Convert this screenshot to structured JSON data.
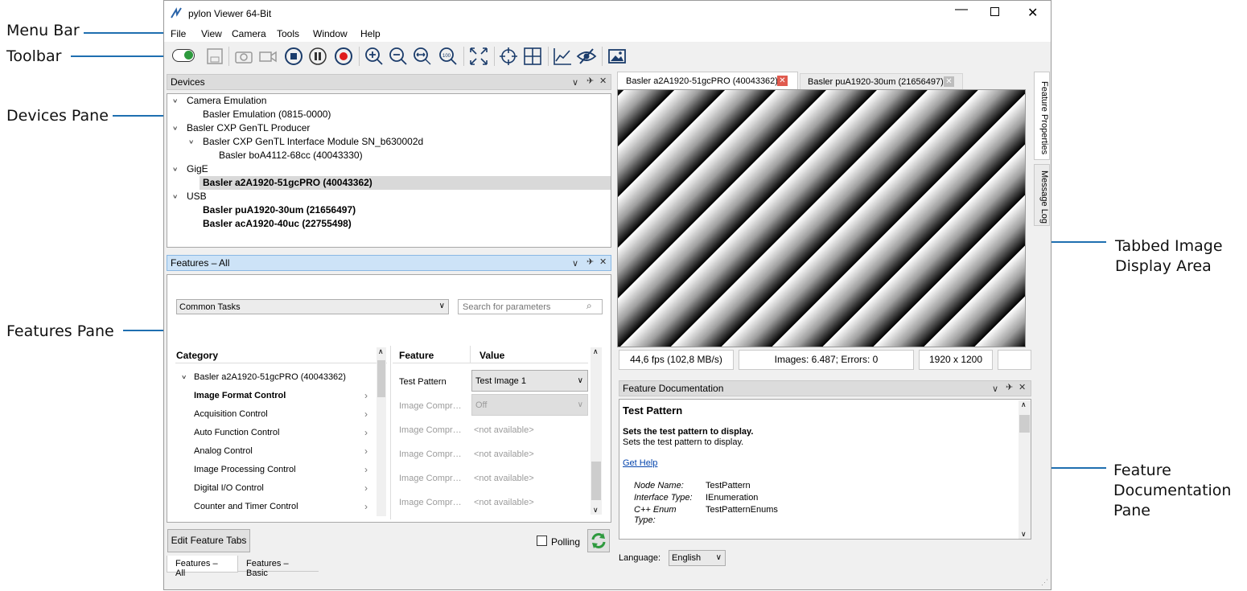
{
  "callouts": {
    "menu_bar": "Menu Bar",
    "toolbar": "Toolbar",
    "devices_pane": "Devices Pane",
    "features_pane": "Features Pane",
    "image_area_line1": "Tabbed Image",
    "image_area_line2": "Display Area",
    "doc_pane_line1": "Feature",
    "doc_pane_line2": "Documentation",
    "doc_pane_line3": "Pane"
  },
  "window": {
    "title": "pylon Viewer 64-Bit"
  },
  "menu": [
    "File",
    "View",
    "Camera",
    "Tools",
    "Window",
    "Help"
  ],
  "toolbar_icons": [
    "toggle-icon",
    "save-icon",
    "camera-icon",
    "video-icon",
    "stop-icon",
    "pause-icon",
    "record-icon",
    "zoom-in-icon",
    "zoom-out-icon",
    "zoom-fit-icon",
    "zoom-100-icon",
    "fullscreen-icon",
    "crosshair-icon",
    "grid-icon",
    "chart-icon",
    "hide-icon",
    "image-icon"
  ],
  "devices": {
    "title": "Devices",
    "rows": [
      {
        "label": "Camera Emulation",
        "indent": 0,
        "expand": true,
        "bold": false,
        "sel": false
      },
      {
        "label": "Basler Emulation (0815-0000)",
        "indent": 1,
        "expand": false,
        "bold": false,
        "sel": false
      },
      {
        "label": "Basler CXP GenTL Producer",
        "indent": 0,
        "expand": true,
        "bold": false,
        "sel": false
      },
      {
        "label": "Basler CXP GenTL Interface Module SN_b630002d",
        "indent": 1,
        "expand": true,
        "bold": false,
        "sel": false
      },
      {
        "label": "Basler boA4112-68cc (40043330)",
        "indent": 2,
        "expand": false,
        "bold": false,
        "sel": false
      },
      {
        "label": "GigE",
        "indent": 0,
        "expand": true,
        "bold": false,
        "sel": false
      },
      {
        "label": "Basler a2A1920-51gcPRO (40043362)",
        "indent": 1,
        "expand": false,
        "bold": true,
        "sel": true
      },
      {
        "label": "USB",
        "indent": 0,
        "expand": true,
        "bold": false,
        "sel": false
      },
      {
        "label": "Basler puA1920-30um (21656497)",
        "indent": 1,
        "expand": false,
        "bold": true,
        "sel": false
      },
      {
        "label": "Basler acA1920-40uc (22755498)",
        "indent": 1,
        "expand": false,
        "bold": true,
        "sel": false
      }
    ]
  },
  "features": {
    "title": "Features – All",
    "task_combo": "Common Tasks",
    "search_placeholder": "Search for parameters",
    "category_header": "Category",
    "feature_header": "Feature",
    "value_header": "Value",
    "categories": [
      {
        "label": "Basler a2A1920-51gcPRO (40043362)",
        "root": true,
        "bold": false
      },
      {
        "label": "Image Format Control",
        "root": false,
        "bold": true
      },
      {
        "label": "Acquisition Control",
        "root": false,
        "bold": false
      },
      {
        "label": "Auto Function Control",
        "root": false,
        "bold": false
      },
      {
        "label": "Analog Control",
        "root": false,
        "bold": false
      },
      {
        "label": "Image Processing Control",
        "root": false,
        "bold": false
      },
      {
        "label": "Digital I/O Control",
        "root": false,
        "bold": false
      },
      {
        "label": "Counter and Timer Control",
        "root": false,
        "bold": false
      }
    ],
    "params": [
      {
        "name": "Test Pattern",
        "value": "Test Image 1",
        "combo": true,
        "enabled": true
      },
      {
        "name": "Image Compr…",
        "value": "Off",
        "combo": true,
        "enabled": false
      },
      {
        "name": "Image Compr…",
        "value": "<not available>",
        "combo": false,
        "enabled": false
      },
      {
        "name": "Image Compr…",
        "value": "<not available>",
        "combo": false,
        "enabled": false
      },
      {
        "name": "Image Compr…",
        "value": "<not available>",
        "combo": false,
        "enabled": false
      },
      {
        "name": "Image Compr…",
        "value": "<not available>",
        "combo": false,
        "enabled": false
      }
    ],
    "edit_tabs_button": "Edit Feature Tabs",
    "polling_label": "Polling",
    "bottom_tabs": [
      "Features – All",
      "Features – Basic"
    ]
  },
  "image_tabs": [
    "Basler a2A1920-51gcPRO (40043362)",
    "Basler puA1920-30um (21656497)"
  ],
  "side_tabs": [
    "Feature Properties",
    "Message Log"
  ],
  "status": {
    "fps": "44,6 fps (102,8 MB/s)",
    "images": "Images: 6.487; Errors: 0",
    "resolution": "1920 x 1200"
  },
  "doc": {
    "title": "Feature Documentation",
    "heading": "Test Pattern",
    "summary": "Sets the test pattern to display.",
    "description": "Sets the test pattern to display.",
    "help_link": "Get Help",
    "node_name_key": "Node Name:",
    "node_name_val": "TestPattern",
    "interface_key": "Interface Type:",
    "interface_val": "IEnumeration",
    "enum_key1": "C++ Enum",
    "enum_key2": "Type:",
    "enum_val": "TestPatternEnums"
  },
  "language": {
    "label": "Language:",
    "value": "English"
  },
  "colors": {
    "accent_blue": "#1f6fb0",
    "pane_selected": "#cde3f7",
    "close_red": "#e05a4e",
    "refresh_green": "#2e9a3e"
  }
}
